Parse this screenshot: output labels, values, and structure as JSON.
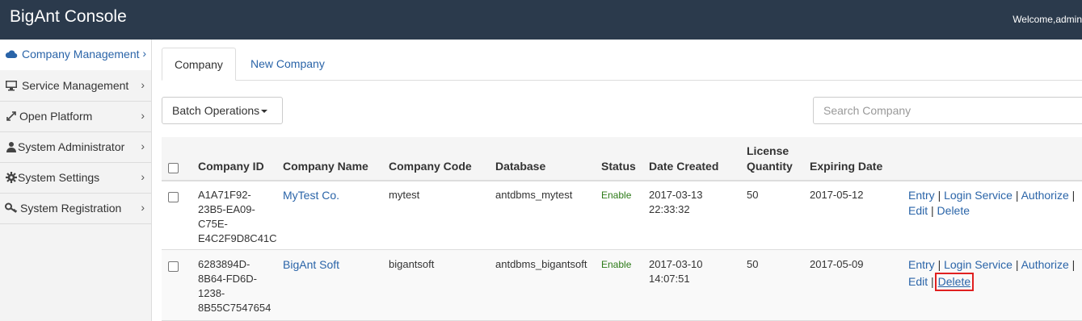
{
  "header": {
    "title": "BigAnt Console",
    "welcome": "Welcome,admin"
  },
  "sidebar": {
    "items": [
      {
        "label": "Company Management",
        "icon": "cloud-icon",
        "active": true
      },
      {
        "label": "Service Management",
        "icon": "monitor-icon"
      },
      {
        "label": "Open Platform",
        "icon": "expand-arrows-icon"
      },
      {
        "label": "System Administrator",
        "icon": "user-icon"
      },
      {
        "label": "System Settings",
        "icon": "gear-icon"
      },
      {
        "label": "System Registration",
        "icon": "key-icon"
      }
    ]
  },
  "tabs": [
    {
      "label": "Company"
    },
    {
      "label": "New Company"
    }
  ],
  "toolbar": {
    "batch_label": "Batch Operations",
    "search_placeholder": "Search Company"
  },
  "table": {
    "headers": {
      "company_id": "Company ID",
      "company_name": "Company Name",
      "company_code": "Company Code",
      "database": "Database",
      "status": "Status",
      "date_created": "Date Created",
      "license_quantity_1": "License",
      "license_quantity_2": "Quantity",
      "expiring_date": "Expiring Date"
    },
    "rows": [
      {
        "id_lines": [
          "A1A71F92-",
          "23B5-EA09-",
          "C75E-",
          "E4C2F9D8C41C"
        ],
        "name": "MyTest Co.",
        "code": "mytest",
        "database": "antdbms_mytest",
        "status": "Enable",
        "created_date": "2017-03-13",
        "created_time": "22:33:32",
        "license": "50",
        "expiring": "2017-05-12"
      },
      {
        "id_lines": [
          "6283894D-",
          "8B64-FD6D-",
          "1238-",
          "8B55C7547654"
        ],
        "name": "BigAnt Soft",
        "code": "bigantsoft",
        "database": "antdbms_bigantsoft",
        "status": "Enable",
        "created_date": "2017-03-10",
        "created_time": "14:07:51",
        "license": "50",
        "expiring": "2017-05-09"
      }
    ],
    "actions": {
      "entry": "Entry",
      "login_service": "Login Service",
      "authorize": "Authorize",
      "edit": "Edit",
      "delete": "Delete",
      "sep": "|"
    }
  },
  "colors": {
    "topbar": "#2b3a4c",
    "link": "#2a64a8",
    "status": "#2c7a17",
    "highlight": "#e02020"
  }
}
